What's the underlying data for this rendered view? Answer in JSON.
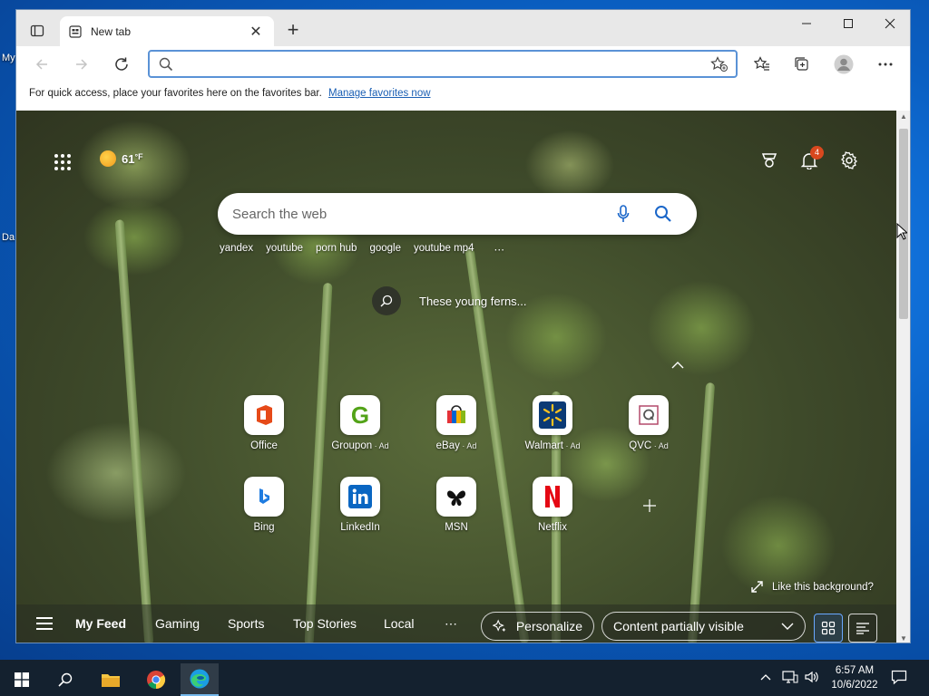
{
  "desktop": {
    "label_1": "My",
    "label_2": "Da"
  },
  "browser": {
    "tab_title": "New tab",
    "tab_close": "✕",
    "new_tab": "+",
    "address_placeholder": "",
    "favbar_text": "For quick access, place your favorites here on the favorites bar.",
    "favbar_link": "Manage favorites now"
  },
  "ntp": {
    "weather_temp": "61",
    "weather_unit": "°F",
    "notifications_count": "4",
    "search_placeholder": "Search the web",
    "trending": [
      "yandex",
      "youtube",
      "porn hub",
      "google",
      "youtube mp4"
    ],
    "trending_more": "⋯",
    "bg_caption": "These young ferns...",
    "tiles": [
      {
        "label": "Office",
        "ad": ""
      },
      {
        "label": "Groupon",
        "ad": " · Ad"
      },
      {
        "label": "eBay",
        "ad": " · Ad"
      },
      {
        "label": "Walmart",
        "ad": " · Ad"
      },
      {
        "label": "QVC",
        "ad": " · Ad"
      },
      {
        "label": "Bing",
        "ad": ""
      },
      {
        "label": "LinkedIn",
        "ad": ""
      },
      {
        "label": "MSN",
        "ad": ""
      },
      {
        "label": "Netflix",
        "ad": ""
      }
    ],
    "like_background": "Like this background?",
    "feed_tabs": [
      "My Feed",
      "Gaming",
      "Sports",
      "Top Stories",
      "Local"
    ],
    "feed_more": "⋯",
    "personalize": "Personalize",
    "content_visibility": "Content partially visible"
  },
  "taskbar": {
    "time": "6:57 AM",
    "date": "10/6/2022"
  },
  "colors": {
    "accent": "#0078d4",
    "taskbar": "#14212f",
    "badge": "#d8481e"
  }
}
